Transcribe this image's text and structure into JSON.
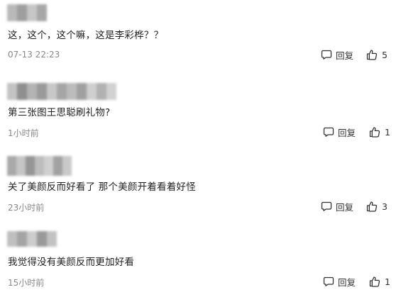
{
  "comments": [
    {
      "text": "这，这个，这个嘛，这是李彩桦？？",
      "time": "07-13 22:23",
      "reply_label": "回复",
      "likes": "5"
    },
    {
      "text": "第三张图王思聪刷礼物?",
      "time": "1小时前",
      "reply_label": "回复",
      "likes": "1"
    },
    {
      "text": "关了美颜反而好看了 那个美颜开着看着好怪",
      "time": "23小时前",
      "reply_label": "回复",
      "likes": "3"
    },
    {
      "text": "我觉得没有美颜反而更加好看",
      "time": "15小时前",
      "reply_label": "回复",
      "likes": "1"
    }
  ],
  "colors": {
    "text": "#222222",
    "meta": "#888888",
    "icon": "#333333"
  },
  "icons": {
    "reply": "comment-bubble-icon",
    "like": "thumbs-up-icon"
  }
}
